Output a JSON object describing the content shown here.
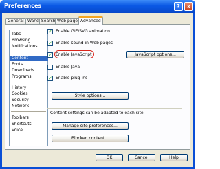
{
  "window": {
    "title": "Preferences",
    "help_icon": "?",
    "close_icon": "×"
  },
  "tabs": [
    "General",
    "Wand",
    "Search",
    "Web pages",
    "Advanced"
  ],
  "sidebar": {
    "groups": [
      [
        "Tabs",
        "Browsing",
        "Notifications"
      ],
      [
        "Content",
        "Fonts",
        "Downloads",
        "Programs"
      ],
      [
        "History",
        "Cookies",
        "Security",
        "Network"
      ],
      [
        "Toolbars",
        "Shortcuts",
        "Voice"
      ]
    ],
    "selected": "Content"
  },
  "options": [
    {
      "label": "Enable GIF/SVG animation",
      "checked": true
    },
    {
      "label": "Enable sound in Web pages",
      "checked": true
    },
    {
      "label": "Enable JavaScript",
      "checked": true
    },
    {
      "label": "Enable Java",
      "checked": false
    },
    {
      "label": "Enable plug-ins",
      "checked": true
    }
  ],
  "buttons": {
    "javascript_options": "JavaScript options...",
    "style_options": "Style options...",
    "manage_site_prefs": "Manage site preferences...",
    "blocked_content": "Blocked content...",
    "ok": "OK",
    "cancel": "Cancel",
    "help": "Help"
  },
  "content_note": "Content settings can be adapted to each site",
  "colors": {
    "highlight_ring": "#d9261c",
    "selection": "#316ac5",
    "title_bar": "#0a58e4"
  }
}
